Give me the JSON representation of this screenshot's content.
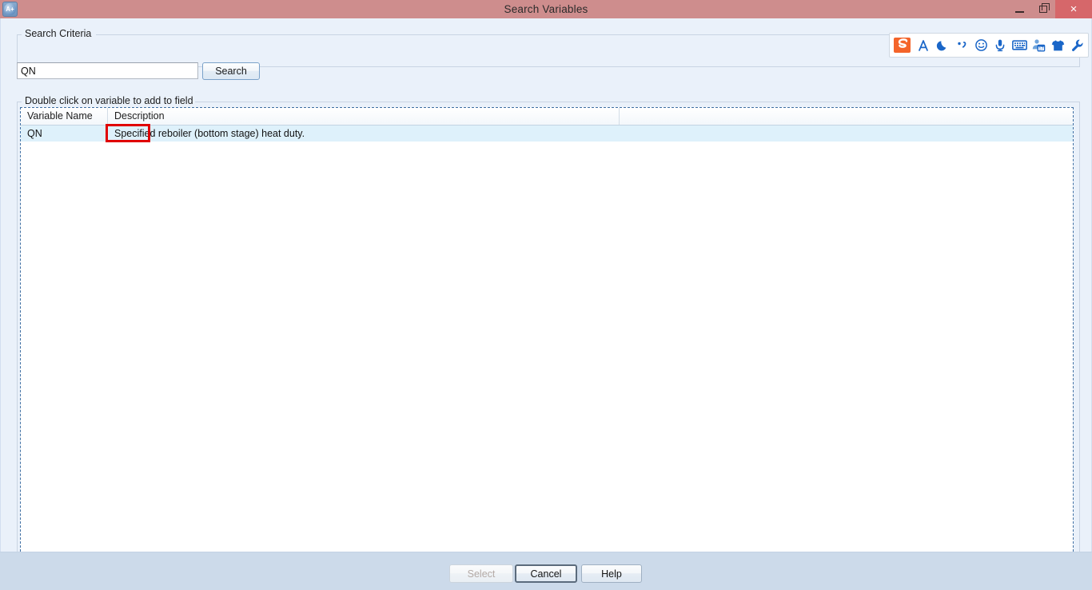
{
  "window": {
    "title": "Search Variables",
    "app_icon": "aspen-plus-icon",
    "app_icon_text": "A+",
    "controls": {
      "minimize": "minimize-icon",
      "restore": "restore-icon",
      "close": "close-icon",
      "close_glyph": "×"
    },
    "titlebar_color": "#ce8d8d",
    "close_button_color": "#d6676a"
  },
  "search_group": {
    "label": "Search Criteria",
    "input_value": "QN",
    "input_placeholder": "",
    "search_button": "Search"
  },
  "list_group": {
    "label": "Double click on variable to add to field"
  },
  "grid": {
    "columns": [
      "Variable Name",
      "Description",
      ""
    ],
    "rows": [
      {
        "variable_name": "QN",
        "description": "Specified reboiler (bottom stage) heat duty.",
        "description_highlight": "Specified",
        "description_rest": " reboiler (bottom stage) heat duty.",
        "extra": "",
        "selected": true
      }
    ],
    "selected_row_color": "#def1fb"
  },
  "annotation": {
    "kind": "red-rectangle-highlight",
    "target_text": "Specified",
    "color": "#e00000"
  },
  "footer": {
    "buttons": [
      {
        "label": "Select",
        "state": "disabled"
      },
      {
        "label": "Cancel",
        "state": "default"
      },
      {
        "label": "Help",
        "state": "normal"
      }
    ]
  },
  "ime_toolbar": {
    "name": "sogou-input-method-toolbar",
    "icons": [
      "sogou-logo-icon",
      "letter-a-icon",
      "moon-icon",
      "comma-icon",
      "smiley-icon",
      "microphone-icon",
      "keyboard-icon",
      "calendar-person-icon",
      "tshirt-icon",
      "wrench-icon"
    ]
  }
}
